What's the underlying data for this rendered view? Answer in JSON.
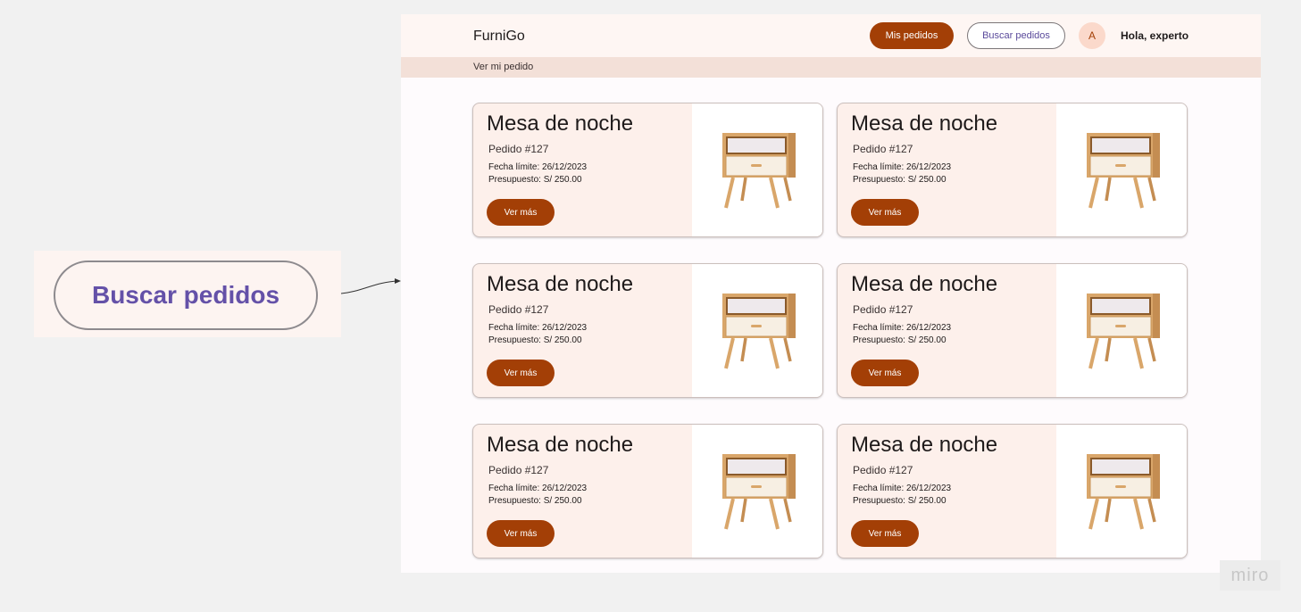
{
  "callout": {
    "label": "Buscar pedidos"
  },
  "header": {
    "brand": "FurniGo",
    "my_orders_label": "Mis pedidos",
    "search_orders_label": "Buscar pedidos",
    "avatar_initial": "A",
    "greeting": "Hola, experto"
  },
  "breadcrumb": {
    "label": "Ver mi pedido"
  },
  "cards": [
    {
      "title": "Mesa de noche",
      "order": "Pedido #127",
      "date": "Fecha límite: 26/12/2023",
      "budget": "Presupuesto: S/ 250.00",
      "button": "Ver más"
    },
    {
      "title": "Mesa de noche",
      "order": "Pedido #127",
      "date": "Fecha límite: 26/12/2023",
      "budget": "Presupuesto: S/ 250.00",
      "button": "Ver más"
    },
    {
      "title": "Mesa de noche",
      "order": "Pedido #127",
      "date": "Fecha límite: 26/12/2023",
      "budget": "Presupuesto: S/ 250.00",
      "button": "Ver más"
    },
    {
      "title": "Mesa de noche",
      "order": "Pedido #127",
      "date": "Fecha límite: 26/12/2023",
      "budget": "Presupuesto: S/ 250.00",
      "button": "Ver más"
    },
    {
      "title": "Mesa de noche",
      "order": "Pedido #127",
      "date": "Fecha límite: 26/12/2023",
      "budget": "Presupuesto: S/ 250.00",
      "button": "Ver más"
    },
    {
      "title": "Mesa de noche",
      "order": "Pedido #127",
      "date": "Fecha límite: 26/12/2023",
      "budget": "Presupuesto: S/ 250.00",
      "button": "Ver más"
    }
  ],
  "watermark": "miro",
  "colors": {
    "accent": "#a33f06",
    "header_bg": "#fef6f3",
    "breadcrumb_bg": "#f3e0d8",
    "card_bg": "#fdf0eb",
    "outline_text": "#5a4a9b"
  }
}
